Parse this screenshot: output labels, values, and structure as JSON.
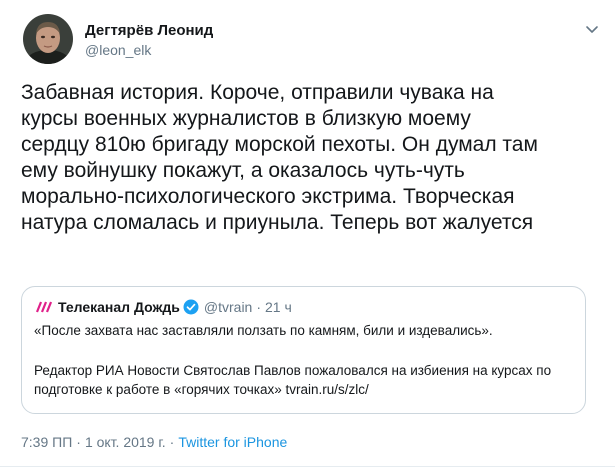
{
  "author": {
    "name": "Дегтярёв Леонид",
    "handle": "@leon_elk"
  },
  "tweet": {
    "text": "Забавная история. Короче, отправили чувака на\nкурсы военных журналистов в близкую моему\nсердцу 810ю бригаду морской пехоты. Он думал там\nему войнушку покажут, а оказалось чуть-чуть\nморально-психологического экстрима. Творческая\nнатура сломалась и приуныла. Теперь вот жалуется"
  },
  "quoted": {
    "name": "Телеканал Дождь",
    "handle": "@tvrain",
    "dot": "·",
    "time": "21 ч",
    "line1": "«После захвата нас заставляли ползать по камням, били и издевались».",
    "line2": "Редактор РИА Новости Святослав Павлов пожаловался на избиения на курсах по подготовке к работе в «горячих точках» tvrain.ru/s/zlc/"
  },
  "footer": {
    "time": "7:39 ПП",
    "sep": "·",
    "date": "1 окт. 2019 г.",
    "sep2": "·",
    "source": "Twitter for iPhone"
  },
  "icons": {
    "avatar": "user-avatar-photo",
    "caret": "chevron-down-icon",
    "channel_logo": "tvrain-logo-icon",
    "verified": "verified-badge-icon"
  },
  "colors": {
    "link": "#1b95e0",
    "secondary": "#657786",
    "border": "#ccd6dd",
    "verified": "#1da1f2",
    "tvrain": "#e0218a"
  }
}
